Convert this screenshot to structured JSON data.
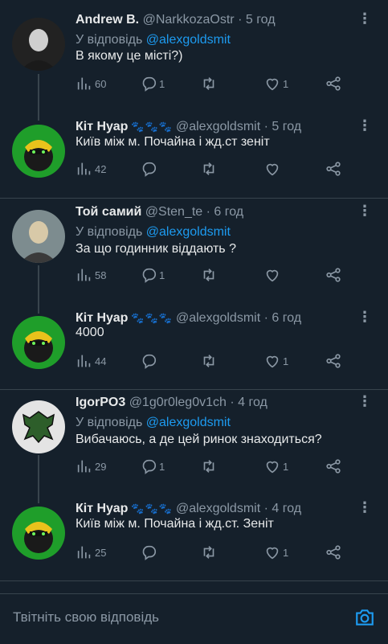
{
  "tweets": [
    {
      "name": "Andrew B.",
      "handle": "@NarkkozaOstr",
      "time": "5 год",
      "reply_prefix": "У відповідь",
      "reply_mention": "@alexgoldsmit",
      "text": "В якому це місті?)",
      "views": "60",
      "replies": "1",
      "retweets": "",
      "likes": "1",
      "paws": false
    },
    {
      "name": "Кіт Нуар",
      "handle": "@alexgoldsmit",
      "time": "5 год",
      "reply_prefix": "",
      "reply_mention": "",
      "text": "Київ між м. Почайна і жд.ст зеніт",
      "views": "42",
      "replies": "",
      "retweets": "",
      "likes": "",
      "paws": true
    },
    {
      "name": "Той самий",
      "handle": "@Sten_te",
      "time": "6 год",
      "reply_prefix": "У відповідь",
      "reply_mention": "@alexgoldsmit",
      "text": "За що годинник віддають ?",
      "views": "58",
      "replies": "1",
      "retweets": "",
      "likes": "",
      "paws": false
    },
    {
      "name": "Кіт Нуар",
      "handle": "@alexgoldsmit",
      "time": "6 год",
      "reply_prefix": "",
      "reply_mention": "",
      "text": "4000",
      "views": "44",
      "replies": "",
      "retweets": "",
      "likes": "1",
      "paws": true
    },
    {
      "name": "IgorPO3",
      "handle": "@1g0r0leg0v1ch",
      "time": "4 год",
      "reply_prefix": "У відповідь",
      "reply_mention": "@alexgoldsmit",
      "text": "Вибачаюсь, а де цей ринок знаходиться?",
      "views": "29",
      "replies": "1",
      "retweets": "",
      "likes": "1",
      "paws": false
    },
    {
      "name": "Кіт Нуар",
      "handle": "@alexgoldsmit",
      "time": "4 год",
      "reply_prefix": "",
      "reply_mention": "",
      "text": "Київ між м. Почайна і жд.ст. Зеніт",
      "views": "25",
      "replies": "",
      "retweets": "",
      "likes": "1",
      "paws": true
    }
  ],
  "compose": {
    "placeholder": "Твітніть свою відповідь"
  },
  "icons": {
    "views": "views-icon",
    "reply": "reply-icon",
    "retweet": "retweet-icon",
    "like": "like-icon",
    "share": "share-icon",
    "camera": "camera-icon",
    "more": "more-icon",
    "paws": "paw-icon"
  },
  "colors": {
    "background": "#15202b",
    "accent": "#1d9bf0",
    "muted": "#8b98a5",
    "text": "#e7e9ea",
    "divider": "#38444d"
  }
}
